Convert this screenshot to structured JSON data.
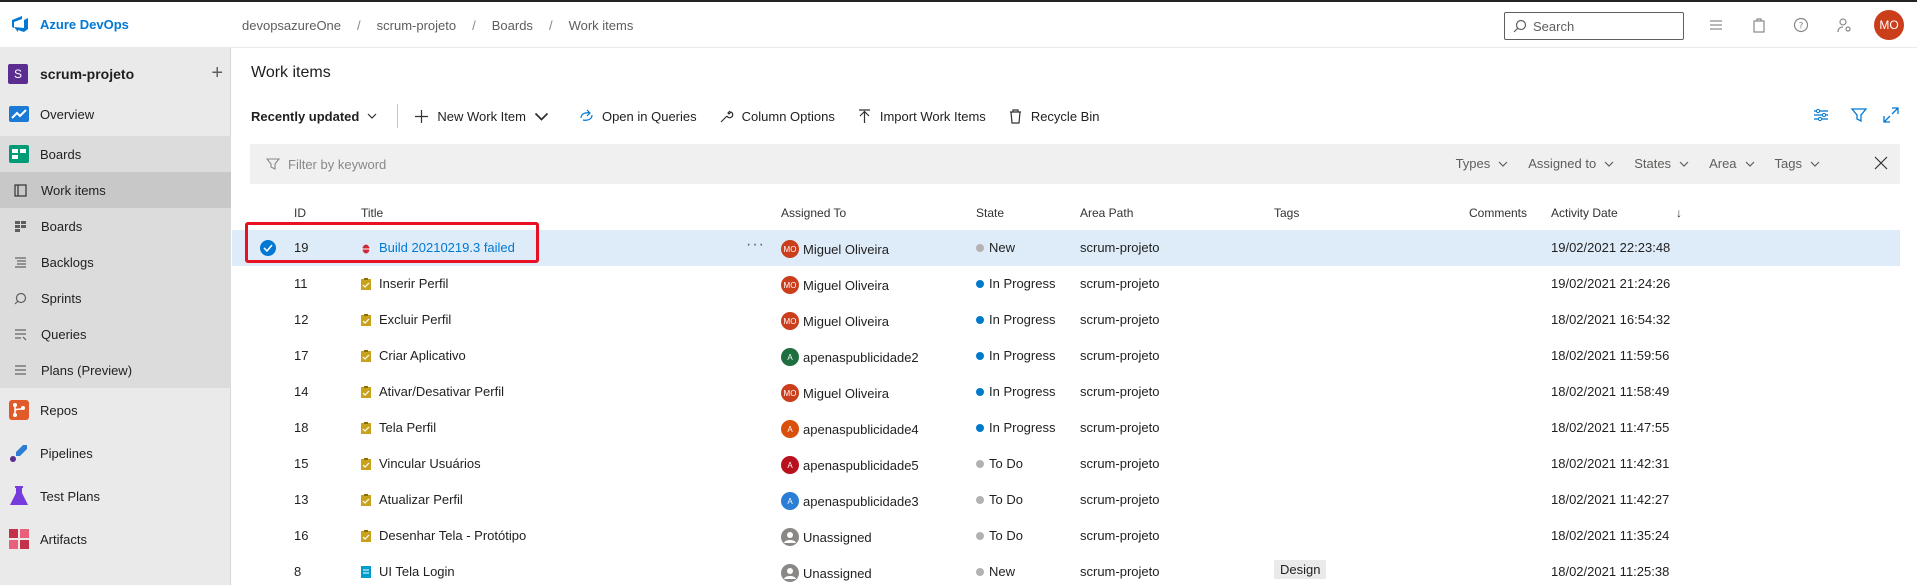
{
  "brand": {
    "name": "Azure DevOps"
  },
  "breadcrumb": [
    "devopsazureOne",
    "scrum-projeto",
    "Boards",
    "Work items"
  ],
  "breadcrumb_sep": "/",
  "search": {
    "placeholder": "Search"
  },
  "user": {
    "initials": "MO"
  },
  "project": {
    "badge": "S",
    "name": "scrum-projeto",
    "add": "+"
  },
  "nav": {
    "overview": "Overview",
    "boards": "Boards",
    "sub": {
      "work_items": "Work items",
      "boards": "Boards",
      "backlogs": "Backlogs",
      "sprints": "Sprints",
      "queries": "Queries",
      "plans": "Plans (Preview)"
    },
    "repos": "Repos",
    "pipelines": "Pipelines",
    "test_plans": "Test Plans",
    "artifacts": "Artifacts"
  },
  "page": {
    "title": "Work items"
  },
  "toolbar": {
    "view": "Recently updated",
    "new_item": "New Work Item",
    "open_queries": "Open in Queries",
    "column_options": "Column Options",
    "import": "Import Work Items",
    "recycle": "Recycle Bin"
  },
  "filter": {
    "placeholder": "Filter by keyword",
    "types": "Types",
    "assigned": "Assigned to",
    "states": "States",
    "area": "Area",
    "tags": "Tags"
  },
  "columns": {
    "id": "ID",
    "title": "Title",
    "assigned": "Assigned To",
    "state": "State",
    "area": "Area Path",
    "tags": "Tags",
    "comments": "Comments",
    "activity": "Activity Date",
    "sort": "↓"
  },
  "more": "···",
  "rows": [
    {
      "id": "19",
      "title": "Build 20210219.3 failed",
      "type": "bug",
      "assigned": "Miguel Oliveira",
      "initials": "MO",
      "av_color": "#ca3e1c",
      "state": "New",
      "state_color": "#b2b2b2",
      "area": "scrum-projeto",
      "tags": "",
      "date": "19/02/2021 22:23:48"
    },
    {
      "id": "11",
      "title": "Inserir Perfil",
      "type": "pbi",
      "assigned": "Miguel Oliveira",
      "initials": "MO",
      "av_color": "#ca3e1c",
      "state": "In Progress",
      "state_color": "#007acc",
      "area": "scrum-projeto",
      "tags": "",
      "date": "19/02/2021 21:24:26"
    },
    {
      "id": "12",
      "title": "Excluir Perfil",
      "type": "pbi",
      "assigned": "Miguel Oliveira",
      "initials": "MO",
      "av_color": "#ca3e1c",
      "state": "In Progress",
      "state_color": "#007acc",
      "area": "scrum-projeto",
      "tags": "",
      "date": "18/02/2021 16:54:32"
    },
    {
      "id": "17",
      "title": "Criar Aplicativo",
      "type": "pbi",
      "assigned": "apenaspublicidade2",
      "initials": "A",
      "av_color": "#1e6e3e",
      "state": "In Progress",
      "state_color": "#007acc",
      "area": "scrum-projeto",
      "tags": "",
      "date": "18/02/2021 11:59:56"
    },
    {
      "id": "14",
      "title": "Ativar/Desativar Perfil",
      "type": "pbi",
      "assigned": "Miguel Oliveira",
      "initials": "MO",
      "av_color": "#ca3e1c",
      "state": "In Progress",
      "state_color": "#007acc",
      "area": "scrum-projeto",
      "tags": "",
      "date": "18/02/2021 11:58:49"
    },
    {
      "id": "18",
      "title": "Tela Perfil",
      "type": "pbi",
      "assigned": "apenaspublicidade4",
      "initials": "A",
      "av_color": "#d94f0c",
      "state": "In Progress",
      "state_color": "#007acc",
      "area": "scrum-projeto",
      "tags": "",
      "date": "18/02/2021 11:47:55"
    },
    {
      "id": "15",
      "title": "Vincular Usuários",
      "type": "pbi",
      "assigned": "apenaspublicidade5",
      "initials": "A",
      "av_color": "#b8101c",
      "state": "To Do",
      "state_color": "#b2b2b2",
      "area": "scrum-projeto",
      "tags": "",
      "date": "18/02/2021 11:42:31"
    },
    {
      "id": "13",
      "title": "Atualizar Perfil",
      "type": "pbi",
      "assigned": "apenaspublicidade3",
      "initials": "A",
      "av_color": "#2a7ed6",
      "state": "To Do",
      "state_color": "#b2b2b2",
      "area": "scrum-projeto",
      "tags": "",
      "date": "18/02/2021 11:42:27"
    },
    {
      "id": "16",
      "title": "Desenhar Tela - Protótipo",
      "type": "pbi",
      "assigned": "Unassigned",
      "initials": "",
      "av_color": "#8a8886",
      "state": "To Do",
      "state_color": "#b2b2b2",
      "area": "scrum-projeto",
      "tags": "",
      "date": "18/02/2021 11:35:24"
    },
    {
      "id": "8",
      "title": "UI Tela Login",
      "type": "story",
      "assigned": "Unassigned",
      "initials": "",
      "av_color": "#8a8886",
      "state": "New",
      "state_color": "#b2b2b2",
      "area": "scrum-projeto",
      "tags": "Design",
      "date": "18/02/2021 11:25:38"
    }
  ]
}
